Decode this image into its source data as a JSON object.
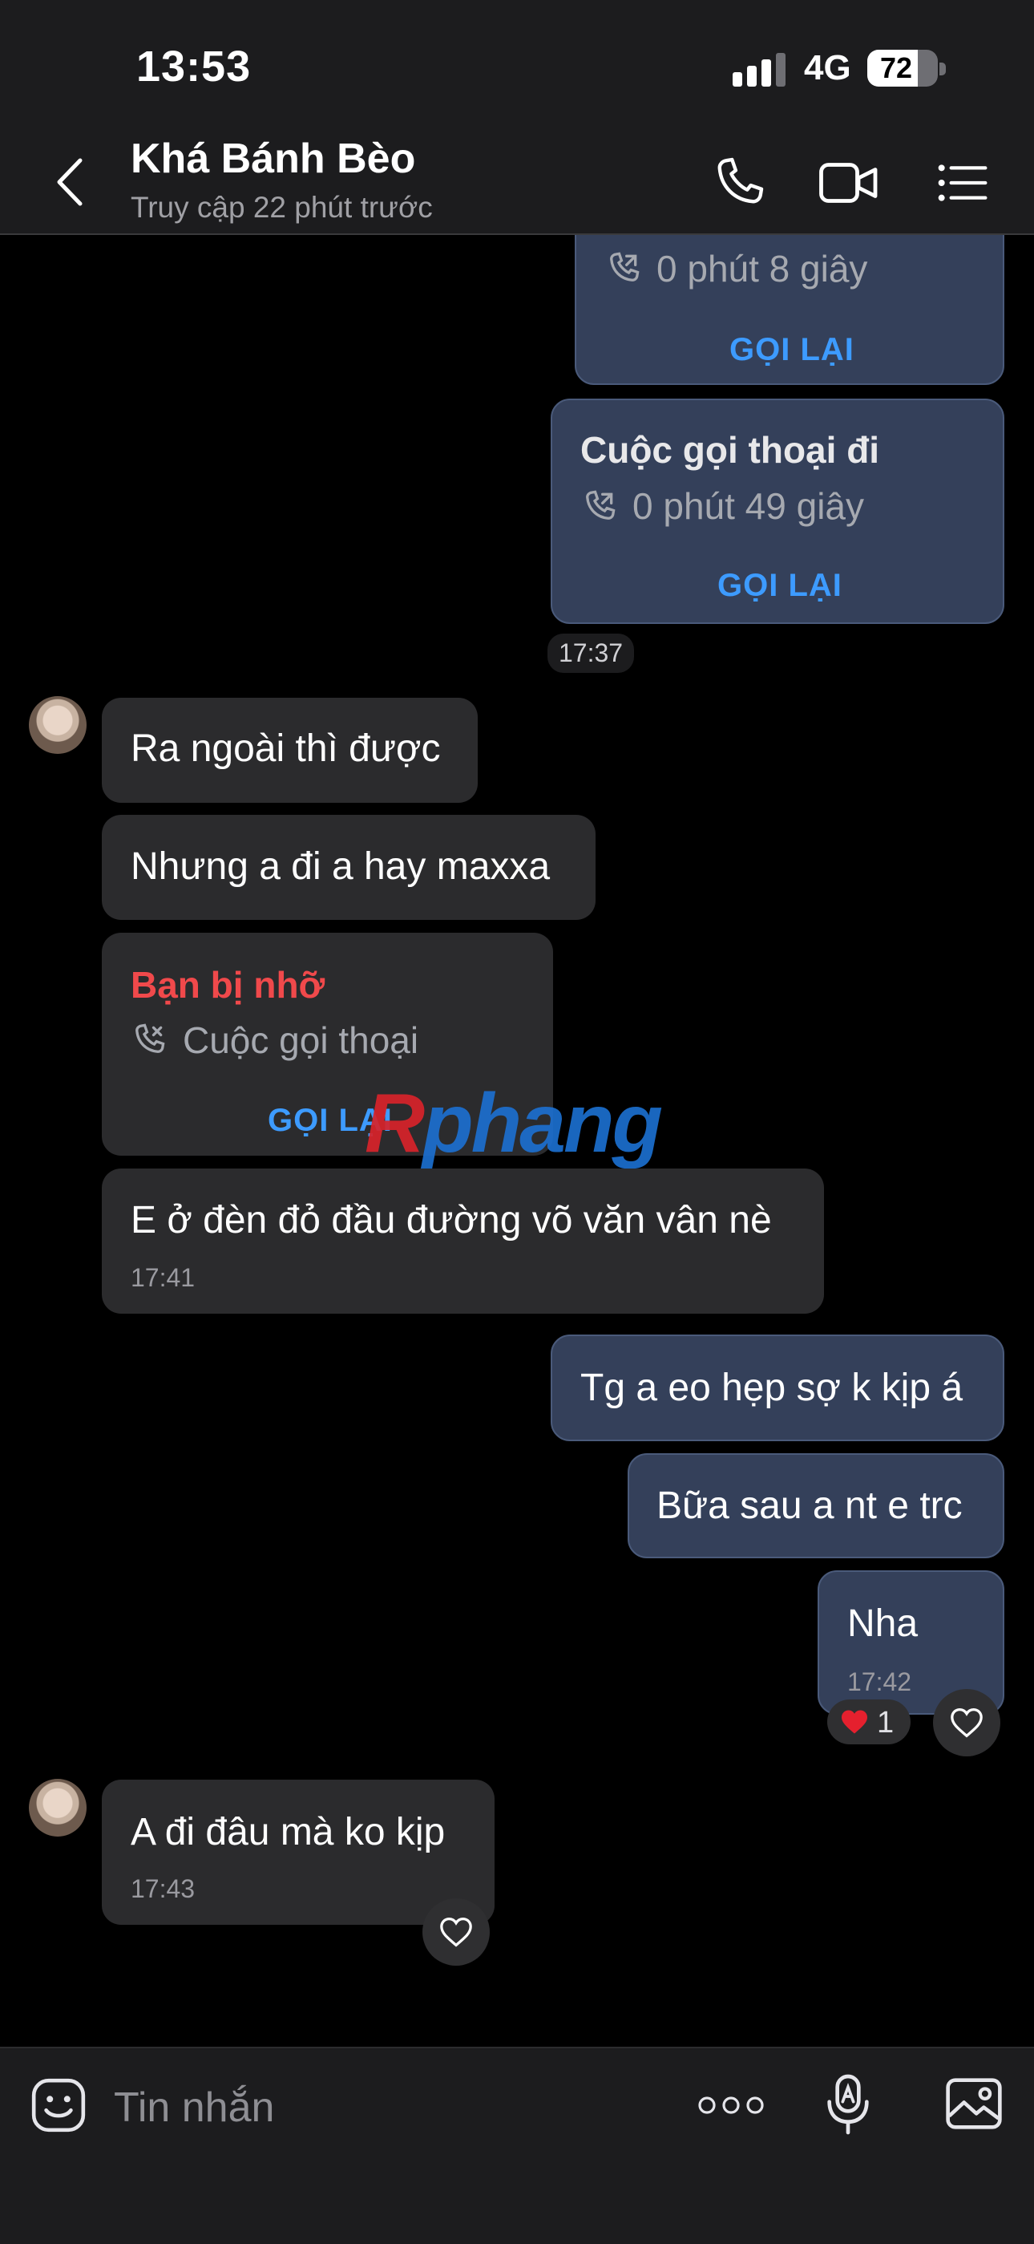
{
  "status_bar": {
    "time": "13:53",
    "network": "4G",
    "battery": "72",
    "battery_level": 0.72,
    "signal_bars": 3
  },
  "header": {
    "contact_name": "Khá Bánh Bèo",
    "last_seen": "Truy cập 22 phút trước",
    "icons": [
      "back-icon",
      "phone-icon",
      "video-camera-icon",
      "menu-list-icon"
    ]
  },
  "messages": {
    "call_top": {
      "duration": "0 phút 8 giây",
      "action": "GỌI LẠI"
    },
    "call_out": {
      "title": "Cuộc gọi thoại đi",
      "duration": "0 phút 49 giây",
      "action": "GỌI LẠI",
      "time": "17:37"
    },
    "m1": {
      "text": "Ra ngoài thì được"
    },
    "m2": {
      "text": "Nhưng a đi a hay maxxa"
    },
    "missed_call": {
      "title": "Bạn bị nhỡ",
      "subtitle": "Cuộc gọi thoại",
      "action": "GỌI LẠI"
    },
    "m3": {
      "text": "E ở đèn đỏ đầu đường võ văn vân nè",
      "time": "17:41"
    },
    "m4": {
      "text": "Tg a eo hẹp sợ k kịp á"
    },
    "m5": {
      "text": "Bữa sau a nt e trc"
    },
    "m6": {
      "text": "Nha",
      "time": "17:42",
      "reaction_count": "1"
    },
    "m7": {
      "text": "A đi đâu mà ko kịp",
      "time": "17:43"
    }
  },
  "composer": {
    "placeholder": "Tin nhắn",
    "icons": [
      "sticker-icon",
      "more-dots-icon",
      "voice-to-text-icon",
      "image-icon"
    ]
  },
  "watermark": {
    "part1": "R",
    "part2": "phang"
  },
  "colors": {
    "sent_bubble": "#34405a",
    "received_bubble": "#2b2b2d",
    "accent_blue": "#3d9bff",
    "missed_red": "#f0494b"
  }
}
